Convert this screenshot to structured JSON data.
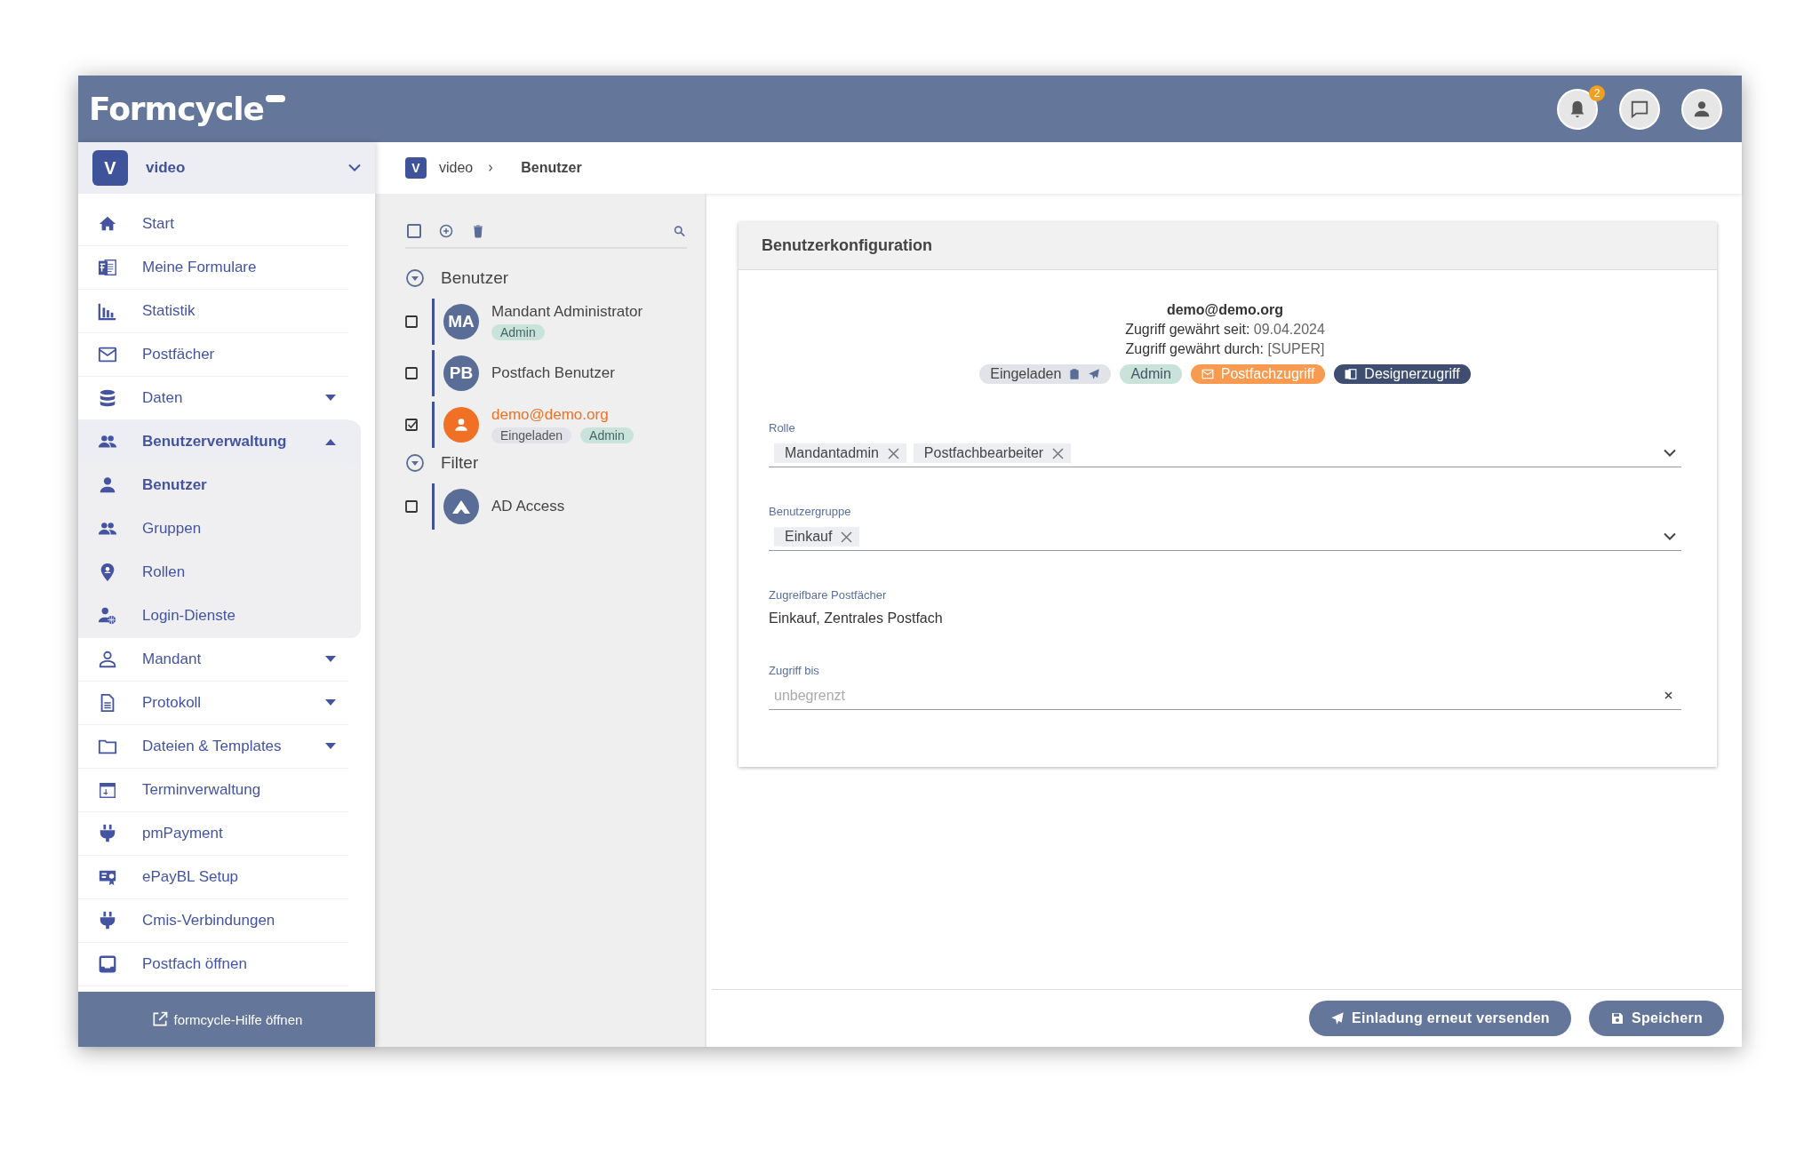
{
  "header": {
    "logo": "Formcycle",
    "notification_count": "2"
  },
  "tenant": {
    "initial": "V",
    "name": "video"
  },
  "sidebar": {
    "items": [
      {
        "label": "Start",
        "kind": "link",
        "selected": false
      },
      {
        "label": "Meine Formulare",
        "kind": "link",
        "selected": false
      },
      {
        "label": "Statistik",
        "kind": "link",
        "selected": false
      },
      {
        "label": "Postfächer",
        "kind": "link",
        "selected": false
      },
      {
        "label": "Daten",
        "kind": "group",
        "expanded": false,
        "selected": false
      },
      {
        "label": "Benutzerverwaltung",
        "kind": "group",
        "expanded": true,
        "selected": true,
        "children": [
          {
            "label": "Benutzer",
            "selected": true
          },
          {
            "label": "Gruppen",
            "selected": false
          },
          {
            "label": "Rollen",
            "selected": false
          },
          {
            "label": "Login-Dienste",
            "selected": false
          }
        ]
      },
      {
        "label": "Mandant",
        "kind": "group",
        "expanded": false,
        "selected": false
      },
      {
        "label": "Protokoll",
        "kind": "group",
        "expanded": false,
        "selected": false
      },
      {
        "label": "Dateien & Templates",
        "kind": "group",
        "expanded": false,
        "selected": false
      },
      {
        "label": "Terminverwaltung",
        "kind": "link",
        "selected": false
      },
      {
        "label": "pmPayment",
        "kind": "link",
        "selected": false
      },
      {
        "label": "ePayBL Setup",
        "kind": "link",
        "selected": false
      },
      {
        "label": "Cmis-Verbindungen",
        "kind": "link",
        "selected": false
      },
      {
        "label": "Postfach öffnen",
        "kind": "link",
        "selected": false
      }
    ],
    "footer": "formcycle-Hilfe öffnen"
  },
  "breadcrumb": {
    "initial": "V",
    "items": [
      "video",
      "Benutzer"
    ]
  },
  "user_list": {
    "groups": [
      {
        "title": "Benutzer",
        "expanded": true,
        "items": [
          {
            "avatar": {
              "kind": "initials",
              "text": "MA"
            },
            "name": "Mandant Administrator",
            "checked": false,
            "selected": false,
            "tags": [
              {
                "label": "Admin",
                "kind": "admin"
              }
            ]
          },
          {
            "avatar": {
              "kind": "initials",
              "text": "PB"
            },
            "name": "Postfach Benutzer",
            "checked": false,
            "selected": false
          },
          {
            "avatar": {
              "kind": "person"
            },
            "name": "demo@demo.org",
            "checked": true,
            "selected": true,
            "tags": [
              {
                "label": "Eingeladen",
                "kind": "invited"
              },
              {
                "label": "Admin",
                "kind": "admin"
              }
            ]
          }
        ]
      },
      {
        "title": "Filter",
        "expanded": true,
        "items": [
          {
            "avatar": {
              "kind": "directory"
            },
            "name": "AD Access",
            "checked": false,
            "selected": false
          }
        ]
      }
    ]
  },
  "config": {
    "title": "Benutzerkonfiguration",
    "email": "demo@demo.org",
    "info": [
      {
        "label": "Zugriff gewährt seit:",
        "value": "09.04.2024"
      },
      {
        "label": "Zugriff gewährt durch:",
        "value": "[SUPER]"
      }
    ],
    "chips": [
      {
        "label": "Eingeladen",
        "kind": "invited"
      },
      {
        "label": "Admin",
        "kind": "admin"
      },
      {
        "label": "Postfachzugriff",
        "kind": "mailbox"
      },
      {
        "label": "Designerzugriff",
        "kind": "designer"
      }
    ],
    "fields": [
      {
        "kind": "multiselect",
        "label": "Rolle",
        "values": [
          "Mandantadmin",
          "Postfachbearbeiter"
        ]
      },
      {
        "kind": "multiselect",
        "label": "Benutzergruppe",
        "values": [
          "Einkauf"
        ]
      },
      {
        "kind": "text",
        "label": "Zugreifbare Postfächer",
        "value": "Einkauf, Zentrales Postfach"
      },
      {
        "kind": "date",
        "label": "Zugriff bis",
        "placeholder": "unbegrenzt"
      }
    ]
  },
  "actions": [
    {
      "label": "Einladung erneut versenden",
      "kind": "send"
    },
    {
      "label": "Speichern",
      "kind": "save"
    }
  ]
}
